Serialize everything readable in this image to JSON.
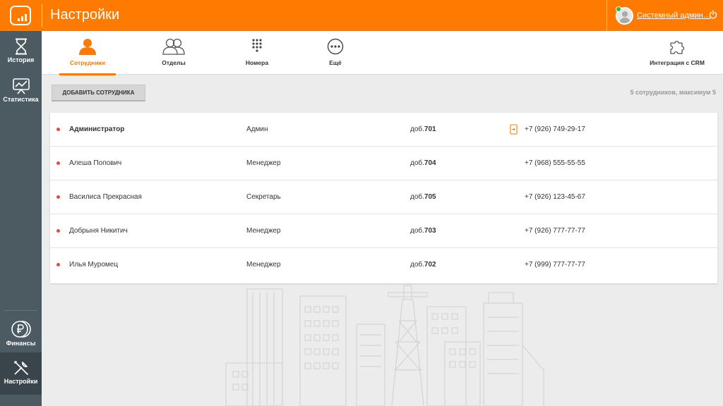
{
  "app": {
    "title": "Настройки",
    "user_name": "Системный админ…"
  },
  "colors": {
    "brand": "#ff7a00",
    "sidebar": "#4c5a61",
    "online": "#2fb54a",
    "status_dot": "#e64b3c"
  },
  "sidebar": {
    "items": [
      {
        "label": "История",
        "icon": "hourglass-icon"
      },
      {
        "label": "Статистика",
        "icon": "chart-board-icon"
      },
      {
        "label": "Финансы",
        "icon": "ruble-coins-icon"
      },
      {
        "label": "Настройки",
        "icon": "tools-icon",
        "active": true
      }
    ]
  },
  "tabs": [
    {
      "label": "Сотрудники",
      "icon": "user-icon",
      "active": true
    },
    {
      "label": "Отделы",
      "icon": "users-icon"
    },
    {
      "label": "Номера",
      "icon": "keypad-icon"
    },
    {
      "label": "Ещё",
      "icon": "more-icon"
    },
    {
      "label": "Интеграция с CRM",
      "icon": "puzzle-icon"
    }
  ],
  "toolbar": {
    "add_label": "ДОБАВИТЬ СОТРУДНИКА",
    "count_text": "5 сотрудников, максимум 5"
  },
  "employees": [
    {
      "name": "Администратор",
      "role": "Админ",
      "ext_prefix": "доб.",
      "ext": "701",
      "phone": "+7 (926) 749-29-17",
      "bold": true,
      "mobile_icon": true
    },
    {
      "name": "Алеша Попович",
      "role": "Менеджер",
      "ext_prefix": "доб.",
      "ext": "704",
      "phone": "+7 (968) 555-55-55"
    },
    {
      "name": "Василиса Прекрасная",
      "role": "Секретарь",
      "ext_prefix": "доб.",
      "ext": "705",
      "phone": "+7 (926) 123-45-67"
    },
    {
      "name": "Добрыня Никитич",
      "role": "Менеджер",
      "ext_prefix": "доб.",
      "ext": "703",
      "phone": "+7 (926) 777-77-77"
    },
    {
      "name": "Илья Муромец",
      "role": "Менеджер",
      "ext_prefix": "доб.",
      "ext": "702",
      "phone": "+7 (999) 777-77-77"
    }
  ]
}
